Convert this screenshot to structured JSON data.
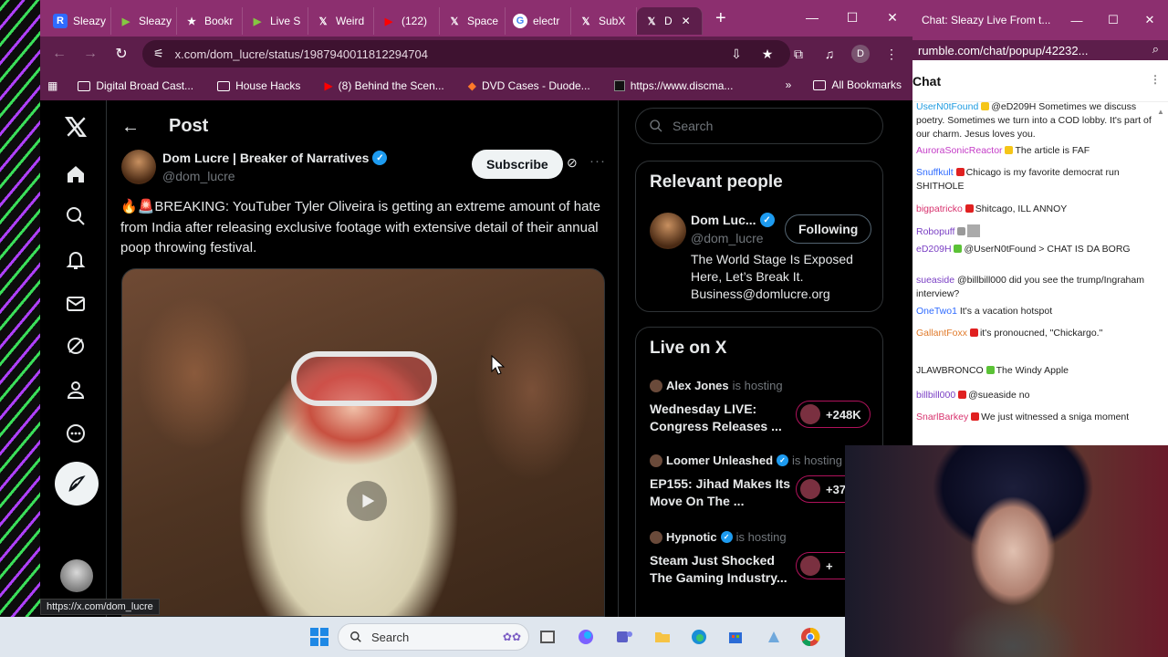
{
  "browser": {
    "tabs": [
      {
        "label": "Sleazy",
        "icon": "rumble-icon",
        "color": "#2f6bff"
      },
      {
        "label": "Sleazy",
        "icon": "rumble-play-icon",
        "color": "#85c742"
      },
      {
        "label": "Bookr",
        "icon": "star-icon",
        "color": "#ffffff"
      },
      {
        "label": "Live S",
        "icon": "rumble-play-icon",
        "color": "#85c742"
      },
      {
        "label": "Weird",
        "icon": "x-logo-icon",
        "color": "#ffffff"
      },
      {
        "label": "(122)",
        "icon": "youtube-icon",
        "color": "#ff0000"
      },
      {
        "label": "Space",
        "icon": "x-logo-icon",
        "color": "#ffffff"
      },
      {
        "label": "electr",
        "icon": "google-icon",
        "color": "#ffffff"
      },
      {
        "label": "SubX",
        "icon": "x-logo-icon",
        "color": "#ffffff"
      },
      {
        "label": "D",
        "icon": "x-logo-icon",
        "color": "#ffffff",
        "active": true
      }
    ],
    "url": "x.com/dom_lucre/status/1987940011812294704",
    "bookmarks": [
      {
        "label": "Digital Broad Cast...",
        "icon": "folder-icon"
      },
      {
        "label": "House Hacks",
        "icon": "folder-icon"
      },
      {
        "label": "(8) Behind the Scen...",
        "icon": "youtube-icon"
      },
      {
        "label": "DVD Cases - Duode...",
        "icon": "store-icon"
      },
      {
        "label": "https://www.discma...",
        "icon": "page-icon"
      }
    ],
    "all_bookmarks": "All Bookmarks",
    "profile_initial": "D",
    "status_url": "https://x.com/dom_lucre"
  },
  "post": {
    "header": "Post",
    "author_name": "Dom Lucre | Breaker of Narratives",
    "author_handle": "@dom_lucre",
    "subscribe_label": "Subscribe",
    "text": "🔥🚨BREAKING: YouTuber Tyler Oliveira is getting an extreme amount of hate from India after releasing exclusive footage with extensive detail of their annual poop throwing festival."
  },
  "sidebar": {
    "search_placeholder": "Search",
    "relevant_title": "Relevant people",
    "person": {
      "name": "Dom Luc...",
      "handle": "@dom_lucre",
      "following_label": "Following",
      "bio": "The World Stage Is Exposed Here, Let’s Break It. Business@domlucre.org"
    },
    "live_title": "Live on X",
    "live": [
      {
        "host": "Alex Jones",
        "hosting": "is hosting",
        "title": "Wednesday LIVE: Congress Releases ...",
        "count": "+248K"
      },
      {
        "host": "Loomer Unleashed",
        "hosting": "is hosting",
        "title": "EP155: Jihad Makes Its Move On The ...",
        "count": "+37"
      },
      {
        "host": "Hypnotic",
        "hosting": "is hosting",
        "title": "Steam Just Shocked The Gaming Industry...",
        "count": "+"
      }
    ]
  },
  "chat": {
    "window_title": "Chat: Sleazy Live From t...",
    "url": "rumble.com/chat/popup/42232...",
    "header": "Chat",
    "messages": [
      {
        "user": "UserN0tFound",
        "color": "#1e9be0",
        "text": "@eD209H Sometimes we discuss poetry. Sometimes we turn into a COD lobby. It's part of our charm. Jesus loves you."
      },
      {
        "user": "AuroraSonicReactor",
        "color": "#c43cc7",
        "text": "The article is FAF"
      },
      {
        "user": "Snuffkult",
        "color": "#2f6bff",
        "text": "Chicago is my favorite democrat run SHITHOLE"
      },
      {
        "user": "bigpatricko",
        "color": "#d8326e",
        "text": "Shitcago, ILL ANNOY"
      },
      {
        "user": "Robopuff",
        "color": "#7a3fc4",
        "text": ""
      },
      {
        "user": "eD209H",
        "color": "#7a3fc4",
        "text": "@UserN0tFound > CHAT IS DA BORG"
      },
      {
        "user": "sueaside",
        "color": "#7a3fc4",
        "text": "@billbill000 did you see the trump/Ingraham interview?"
      },
      {
        "user": "OneTwo1",
        "color": "#2f6bff",
        "text": "It's a vacation hotspot"
      },
      {
        "user": "GallantFoxx",
        "color": "#e07a2a",
        "text": "it's pronoucned, \"Chickargo.\""
      },
      {
        "user": "JLAWBRONCO",
        "color": "#222222",
        "text": "The Windy Apple"
      },
      {
        "user": "billbill000",
        "color": "#7a3fc4",
        "text": "@sueaside no"
      },
      {
        "user": "SnarlBarkey",
        "color": "#d8326e",
        "text": "We just witnessed a sniga moment"
      }
    ]
  },
  "taskbar": {
    "search_label": "Search"
  },
  "colors": {
    "x_blue": "#1d9bf0",
    "browser_frame": "#8c2f6f",
    "browser_toolbar": "#5d1e4b"
  }
}
